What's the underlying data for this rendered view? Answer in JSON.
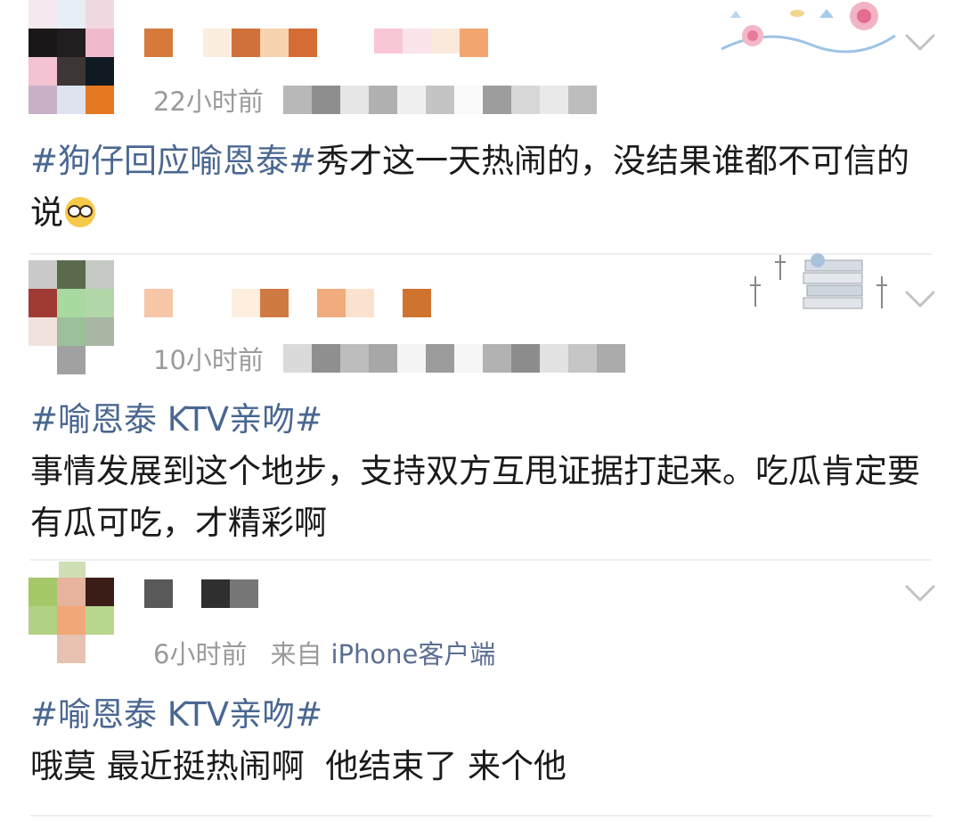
{
  "posts": [
    {
      "time": "22小时前",
      "topic": "#狗仔回应喻恩泰#",
      "text": "秀才这一天热闹的，没结果谁都不可信的说",
      "emoji": "nerd-face-emoji"
    },
    {
      "time": "10小时前",
      "topic": "#喻恩泰 KTV亲吻#",
      "text": "事情发展到这个地步，支持双方互甩证据打起来。吃瓜肯定要有瓜可吃，才精彩啊"
    },
    {
      "time": "6小时前",
      "source_prefix": "来自",
      "source_name": "iPhone客户端",
      "topic": "#喻恩泰 KTV亲吻#",
      "text": "哦莫 最近挺热闹啊  他结束了 来个他"
    }
  ],
  "icons": {
    "expand": "chevron-down-icon"
  },
  "colors": {
    "topic": "#4a6791",
    "meta": "#9a9a9a",
    "text": "#1a1a1a",
    "source": "#5b6e92"
  }
}
